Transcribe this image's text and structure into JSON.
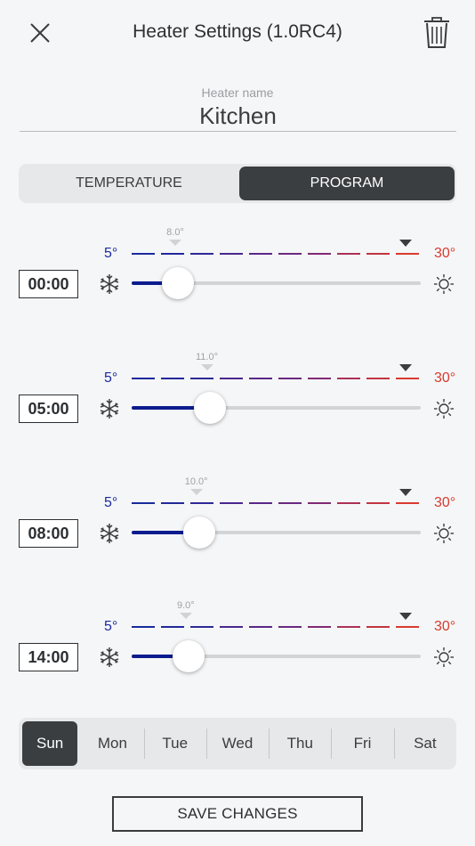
{
  "header": {
    "title": "Heater Settings (1.0RC4)",
    "close_icon": "close-icon",
    "delete_icon": "trash-icon"
  },
  "heater_name": {
    "label": "Heater name",
    "value": "Kitchen"
  },
  "mode_tabs": [
    {
      "label": "TEMPERATURE",
      "selected": false
    },
    {
      "label": "PROGRAM",
      "selected": true
    }
  ],
  "scale": {
    "min_label": "5°",
    "max_label": "30°",
    "min_value": 5,
    "max_value": 30,
    "cold_icon": "snowflake-icon",
    "hot_icon": "sun-icon"
  },
  "program": [
    {
      "time": "00:00",
      "temp": 8.0,
      "temp_label": "8.0°"
    },
    {
      "time": "05:00",
      "temp": 11.0,
      "temp_label": "11.0°"
    },
    {
      "time": "08:00",
      "temp": 10.0,
      "temp_label": "10.0°"
    },
    {
      "time": "14:00",
      "temp": 9.0,
      "temp_label": "9.0°"
    }
  ],
  "days": [
    {
      "label": "Sun",
      "selected": true
    },
    {
      "label": "Mon",
      "selected": false
    },
    {
      "label": "Tue",
      "selected": false
    },
    {
      "label": "Wed",
      "selected": false
    },
    {
      "label": "Thu",
      "selected": false
    },
    {
      "label": "Fri",
      "selected": false
    },
    {
      "label": "Sat",
      "selected": false
    }
  ],
  "save_label": "SAVE CHANGES",
  "colors": {
    "cold": "#0d1c8e",
    "hot": "#d83b2f",
    "dark": "#3b3e41",
    "track": "#d2d4d7"
  }
}
